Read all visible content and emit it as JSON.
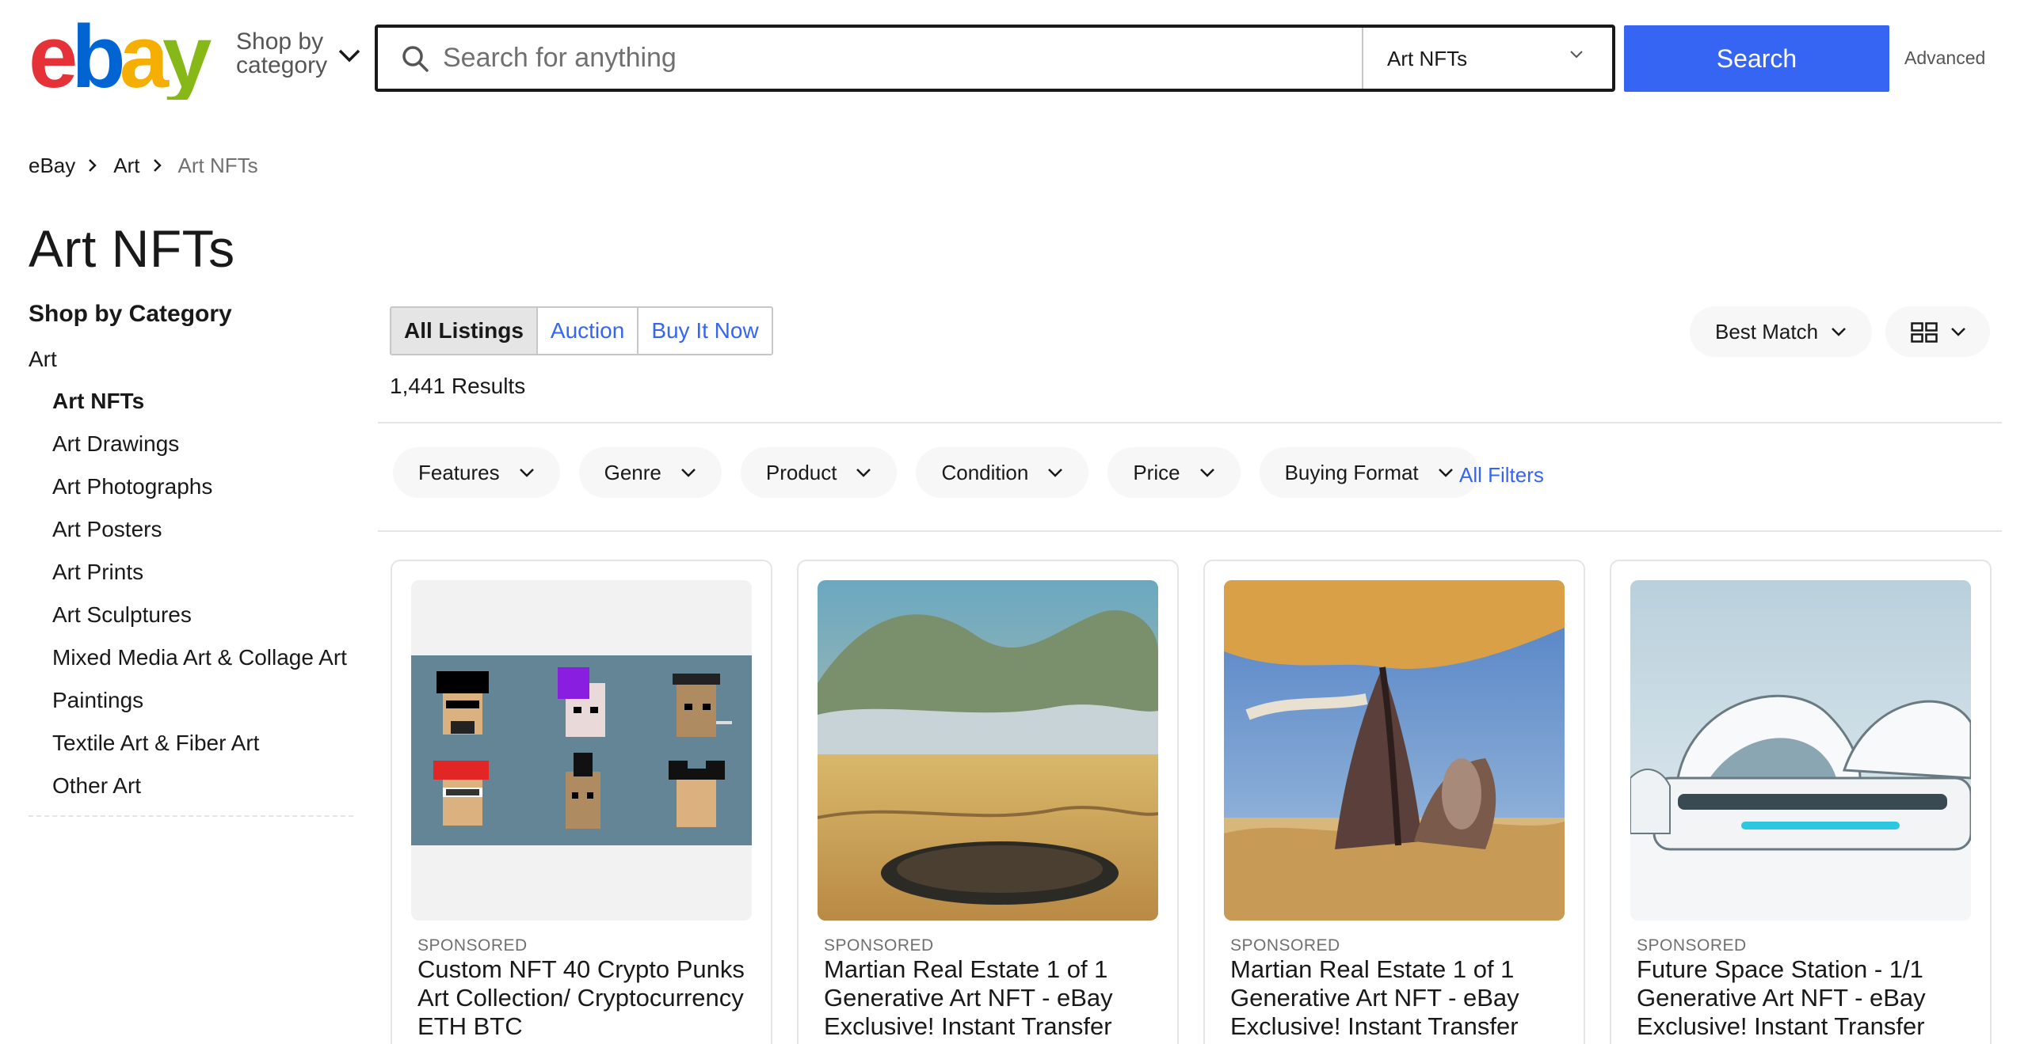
{
  "header": {
    "logo_text": "ebay",
    "shop_by_line1": "Shop by",
    "shop_by_line2": "category",
    "search_placeholder": "Search for anything",
    "category_select": "Art NFTs",
    "search_button": "Search",
    "advanced_link": "Advanced",
    "colors": {
      "accent": "#3665f3",
      "logo_e": "#e53238",
      "logo_b": "#0064d2",
      "logo_a": "#f5af02",
      "logo_y": "#86b817"
    }
  },
  "breadcrumb": [
    {
      "label": "eBay"
    },
    {
      "label": "Art"
    },
    {
      "label": "Art NFTs"
    }
  ],
  "page_title": "Art NFTs",
  "sidebar": {
    "heading": "Shop by Category",
    "root": "Art",
    "items": [
      {
        "label": "Art NFTs",
        "current": true
      },
      {
        "label": "Art Drawings"
      },
      {
        "label": "Art Photographs"
      },
      {
        "label": "Art Posters"
      },
      {
        "label": "Art Prints"
      },
      {
        "label": "Art Sculptures"
      },
      {
        "label": "Mixed Media Art & Collage Art"
      },
      {
        "label": "Paintings"
      },
      {
        "label": "Textile Art & Fiber Art"
      },
      {
        "label": "Other Art"
      }
    ]
  },
  "listing_tabs": [
    {
      "label": "All Listings",
      "active": true
    },
    {
      "label": "Auction"
    },
    {
      "label": "Buy It Now"
    }
  ],
  "results_count": "1,441 Results",
  "sort": {
    "label": "Best Match",
    "icon": "chevron-down-icon"
  },
  "view_toggle": {
    "icon": "grid-view-icon"
  },
  "filters": [
    {
      "label": "Features"
    },
    {
      "label": "Genre"
    },
    {
      "label": "Product"
    },
    {
      "label": "Condition"
    },
    {
      "label": "Price"
    },
    {
      "label": "Buying Format"
    }
  ],
  "all_filters": "All Filters",
  "products": [
    {
      "sponsored": "SPONSORED",
      "title": "Custom NFT 40 Crypto Punks Art Collection/ Cryptocurrency ETH BTC",
      "image": "pixel-punk-avatars"
    },
    {
      "sponsored": "SPONSORED",
      "title": "Martian Real Estate 1 of 1 Generative Art NFT - eBay Exclusive! Instant Transfer",
      "image": "surreal-desert-landscape"
    },
    {
      "sponsored": "SPONSORED",
      "title": "Martian Real Estate 1 of 1 Generative Art NFT - eBay Exclusive! Instant Transfer",
      "image": "rock-spire-landscape"
    },
    {
      "sponsored": "SPONSORED",
      "title": "Future Space Station - 1/1 Generative Art NFT - eBay Exclusive! Instant Transfer",
      "image": "futuristic-white-domes"
    }
  ]
}
